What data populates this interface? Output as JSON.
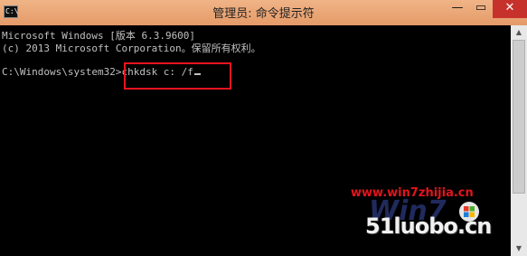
{
  "window": {
    "title": "管理员: 命令提示符",
    "icon_text": "C:\\",
    "controls": {
      "minimize": "—",
      "maximize": "▭",
      "close": "✕"
    }
  },
  "console": {
    "lines": [
      "Microsoft Windows [版本 6.3.9600]",
      "(c) 2013 Microsoft Corporation。保留所有权利。",
      "",
      "C:\\Windows\\system32>chkdsk c: /f"
    ]
  },
  "scrollbar": {
    "up": "▲",
    "down": "▼"
  },
  "watermark": {
    "url": "www.win7zhijia.cn",
    "logo": "51luobo.cn",
    "bg_text": "Win7"
  },
  "colors": {
    "titlebar": "#e59a68",
    "console_bg": "#000000",
    "console_text": "#c0c0c0",
    "highlight_border": "#e8141e",
    "close_button": "#c7312b"
  }
}
